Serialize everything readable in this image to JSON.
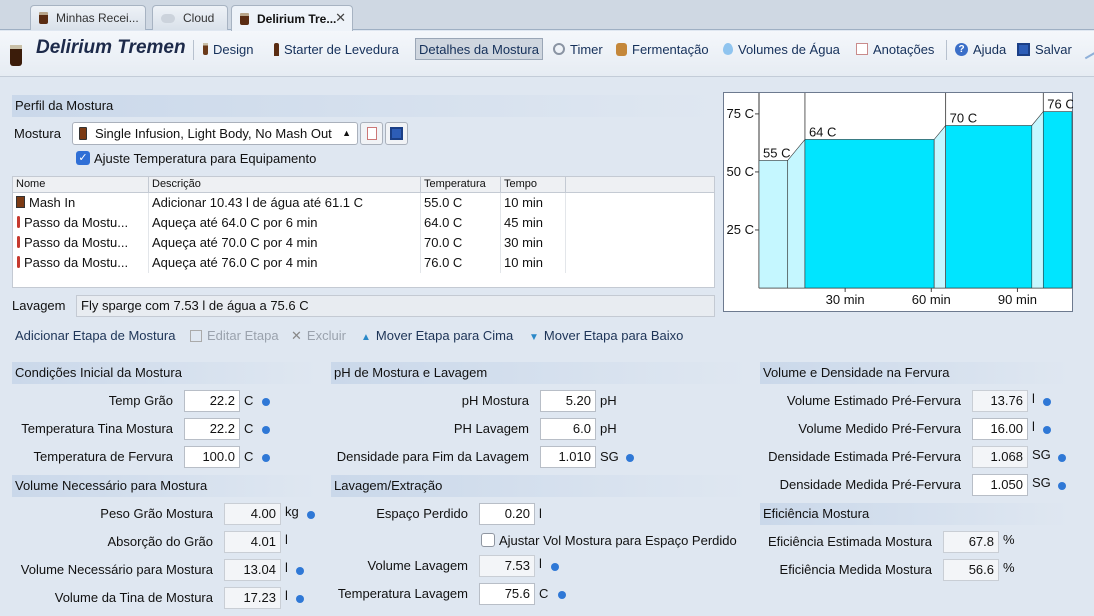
{
  "tabs": [
    {
      "label": "Minhas Recei..."
    },
    {
      "label": "Cloud"
    },
    {
      "label": "Delirium Tre...",
      "close": "✕"
    }
  ],
  "toolbar": {
    "recipe_title": "Delirium Tremens",
    "items": {
      "design": "Design",
      "starter": "Starter de Levedura",
      "mash_details": "Detalhes da Mostura",
      "timer": "Timer",
      "fermentation": "Fermentação",
      "water": "Volumes de Água",
      "notes": "Anotações",
      "help": "Ajuda",
      "save": "Salvar"
    }
  },
  "mash_profile": {
    "header": "Perfil da Mostura",
    "label": "Mostura",
    "selected": "Single Infusion, Light Body, No Mash Out",
    "adjust_label": "Ajuste Temperatura para Equipamento",
    "columns": [
      "Nome",
      "Descrição",
      "Temperatura",
      "Tempo"
    ],
    "steps": [
      {
        "name": "Mash In",
        "desc": "Adicionar 10.43 l de água até 61.1 C",
        "temp": "55.0 C",
        "time": "10 min"
      },
      {
        "name": "Passo da Mostu...",
        "desc": "Aqueça até 64.0 C por 6 min",
        "temp": "64.0 C",
        "time": "45 min"
      },
      {
        "name": "Passo da Mostu...",
        "desc": "Aqueça até 70.0 C por 4 min",
        "temp": "70.0 C",
        "time": "30 min"
      },
      {
        "name": "Passo da Mostu...",
        "desc": "Aqueça até 76.0 C por 4 min",
        "temp": "76.0 C",
        "time": "10 min"
      }
    ],
    "sparge_label": "Lavagem",
    "sparge_value": "Fly sparge com 7.53 l de água a 75.6 C"
  },
  "actions": {
    "add": "Adicionar Etapa de Mostura",
    "edit": "Editar Etapa",
    "delete": "Excluir",
    "up": "Mover Etapa para Cima",
    "down": "Mover Etapa para Baixo"
  },
  "chart_data": {
    "type": "area",
    "x_ticks": [
      "30 min",
      "60 min",
      "90 min"
    ],
    "y_ticks": [
      "75 C",
      "50 C",
      "25 C"
    ],
    "step_labels": [
      "55 C",
      "64 C",
      "70 C",
      "76 C"
    ],
    "steps": [
      {
        "temp": 55,
        "start": 0,
        "hold": 10
      },
      {
        "temp": 64,
        "start": 16,
        "hold": 45
      },
      {
        "temp": 70,
        "start": 65,
        "hold": 30
      },
      {
        "temp": 76,
        "start": 99,
        "hold": 10
      }
    ],
    "xlim": [
      0,
      109
    ],
    "ylim": [
      0,
      84
    ],
    "fill_color": "#00e5ff",
    "ramp_color": "#c5f7ff"
  },
  "initial_conditions": {
    "header": "Condições Inicial da Mostura",
    "grain_temp_label": "Temp Grão",
    "grain_temp": "22.2",
    "grain_temp_unit": "C",
    "tun_temp_label": "Temperatura Tina Mostura",
    "tun_temp": "22.2",
    "tun_temp_unit": "C",
    "boil_temp_label": "Temperatura de Fervura",
    "boil_temp": "100.0",
    "boil_temp_unit": "C"
  },
  "volume_needed": {
    "header": "Volume Necessário para Mostura",
    "grain_weight_label": "Peso Grão Mostura",
    "grain_weight": "4.00",
    "grain_weight_unit": "kg",
    "grain_abs_label": "Absorção do Grão",
    "grain_abs": "4.01",
    "grain_abs_unit": "l",
    "vol_needed_label": "Volume Necessário para Mostura",
    "vol_needed": "13.04",
    "vol_needed_unit": "l",
    "tun_vol_label": "Volume da Tina de Mostura",
    "tun_vol": "17.23",
    "tun_vol_unit": "l"
  },
  "ph": {
    "header": "pH de Mostura e Lavagem",
    "mash_ph_label": "pH Mostura",
    "mash_ph": "5.20",
    "mash_ph_unit": "pH",
    "sparge_ph_label": "PH Lavagem",
    "sparge_ph": "6.0",
    "sparge_ph_unit": "pH",
    "end_gravity_label": "Densidade para Fim da Lavagem",
    "end_gravity": "1.010",
    "end_gravity_unit": "SG"
  },
  "sparge": {
    "header": "Lavagem/Extração",
    "dead_space_label": "Espaço Perdido",
    "dead_space": "0.20",
    "dead_space_unit": "l",
    "adjust_label": "Ajustar Vol Mostura para Espaço Perdido",
    "volume_label": "Volume Lavagem",
    "volume": "7.53",
    "volume_unit": "l",
    "temp_label": "Temperatura Lavagem",
    "temp": "75.6",
    "temp_unit": "C"
  },
  "boil": {
    "header": "Volume e Densidade na Fervura",
    "est_vol_label": "Volume Estimado Pré-Fervura",
    "est_vol": "13.76",
    "est_vol_unit": "l",
    "meas_vol_label": "Volume Medido Pré-Fervura",
    "meas_vol": "16.00",
    "meas_vol_unit": "l",
    "est_grav_label": "Densidade Estimada Pré-Fervura",
    "est_grav": "1.068",
    "est_grav_unit": "SG",
    "meas_grav_label": "Densidade Medida Pré-Fervura",
    "meas_grav": "1.050",
    "meas_grav_unit": "SG"
  },
  "efficiency": {
    "header": "Eficiência Mostura",
    "est_label": "Eficiência Estimada Mostura",
    "est": "67.8",
    "est_unit": "%",
    "meas_label": "Eficiência Medida Mostura",
    "meas": "56.6",
    "meas_unit": "%"
  }
}
